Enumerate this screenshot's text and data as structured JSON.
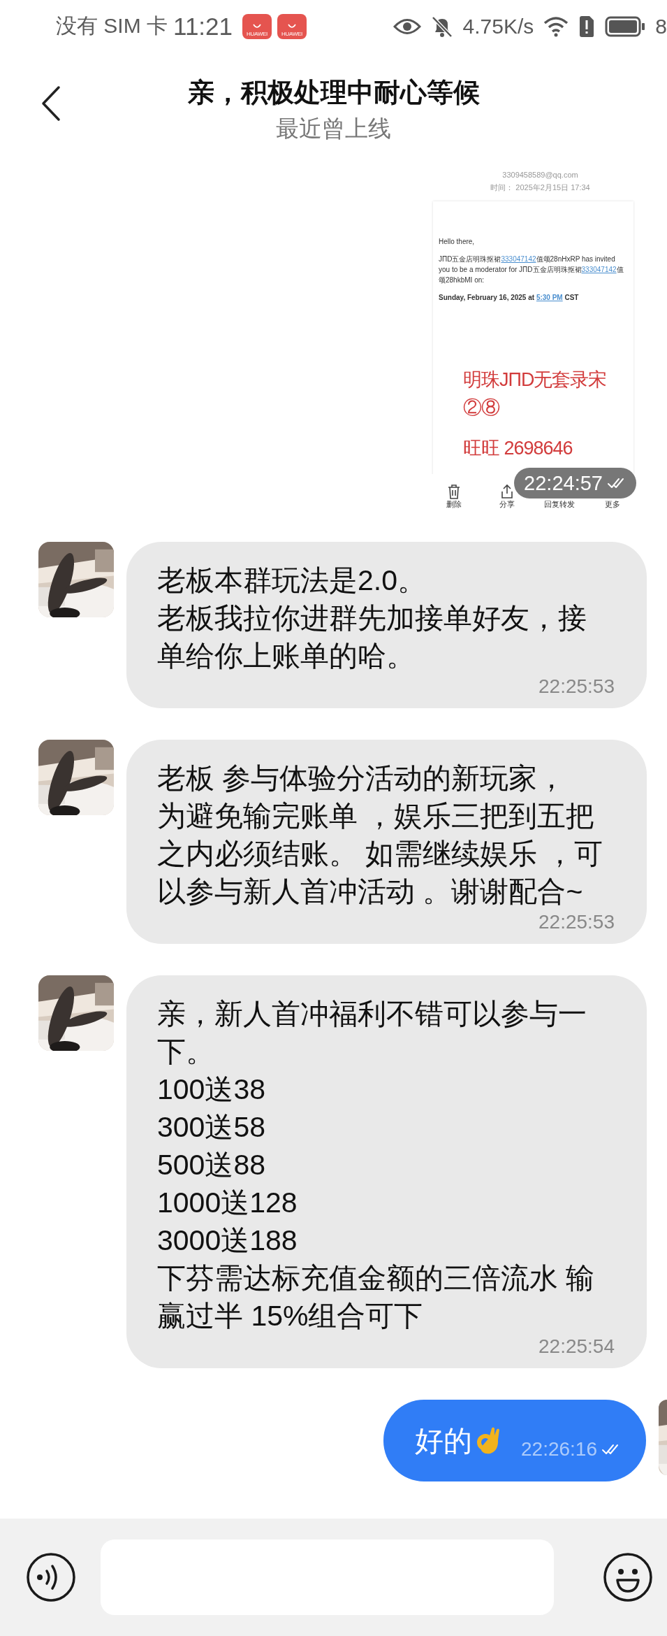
{
  "status_bar": {
    "carrier": "没有 SIM 卡",
    "time": "11:21",
    "app_badges": [
      {
        "label": "HUAWEI"
      },
      {
        "label": "HUAWEI"
      }
    ],
    "net_speed": "4.75K/s",
    "battery": "8"
  },
  "header": {
    "title": "亲，积极处理中耐心等候",
    "subtitle": "最近曾上线"
  },
  "messages": [
    {
      "time": "22:24:57",
      "read": true,
      "email": {
        "sender": "3309458589@qq.com",
        "time_label": "时间：",
        "time": "2025年2月15日 17:34",
        "greeting": "Hello there,",
        "body": [
          {
            "text": "JΠD五金店明珠抠裙",
            "link": false
          },
          {
            "text": "333047142",
            "link": true
          },
          {
            "text": "值颂28nHxRP has invited you to be a moderator for JΠD五金店明珠抠裙",
            "link": false
          },
          {
            "text": "333047142",
            "link": true
          },
          {
            "text": "值颂28hkbMI on:",
            "link": false
          }
        ],
        "date_line": [
          {
            "text": "Sunday, February 16, 2025 at ",
            "link": false
          },
          {
            "text": "5:30 PM",
            "link": true
          },
          {
            "text": " CST",
            "link": false
          }
        ],
        "banner_lines": [
          "明珠JΠD无套录宋②⑧",
          "旺旺 2698646"
        ],
        "actions": [
          {
            "label": "删除"
          },
          {
            "label": "分享"
          },
          {
            "label": "回复转发"
          },
          {
            "label": "更多"
          }
        ]
      }
    },
    {
      "kind": "incoming",
      "paragraphs": [
        "老板本群玩法是2.0。",
        "老板我拉你进群先加接单好友，接单给你上账单的哈。"
      ],
      "time": "22:25:53"
    },
    {
      "kind": "incoming",
      "paragraphs": [
        "老板  参与体验分活动的新玩家，",
        "为避免输完账单 ，娱乐三把到五把之内必须结账。 如需继续娱乐 ，可以参与新人首冲活动 。谢谢配合~"
      ],
      "time": "22:25:53"
    },
    {
      "kind": "incoming",
      "paragraphs": [
        "亲，新人首冲福利不错可以参与一下。",
        "100送38",
        "300送58",
        "500送88",
        "1000送128",
        "3000送188",
        "下芬需达标充值金额的三倍流水 输赢过半 15%组合可下"
      ],
      "time": "22:25:54"
    },
    {
      "kind": "outgoing",
      "paragraphs": [
        "好的"
      ],
      "time": "22:26:16",
      "read": true
    }
  ]
}
